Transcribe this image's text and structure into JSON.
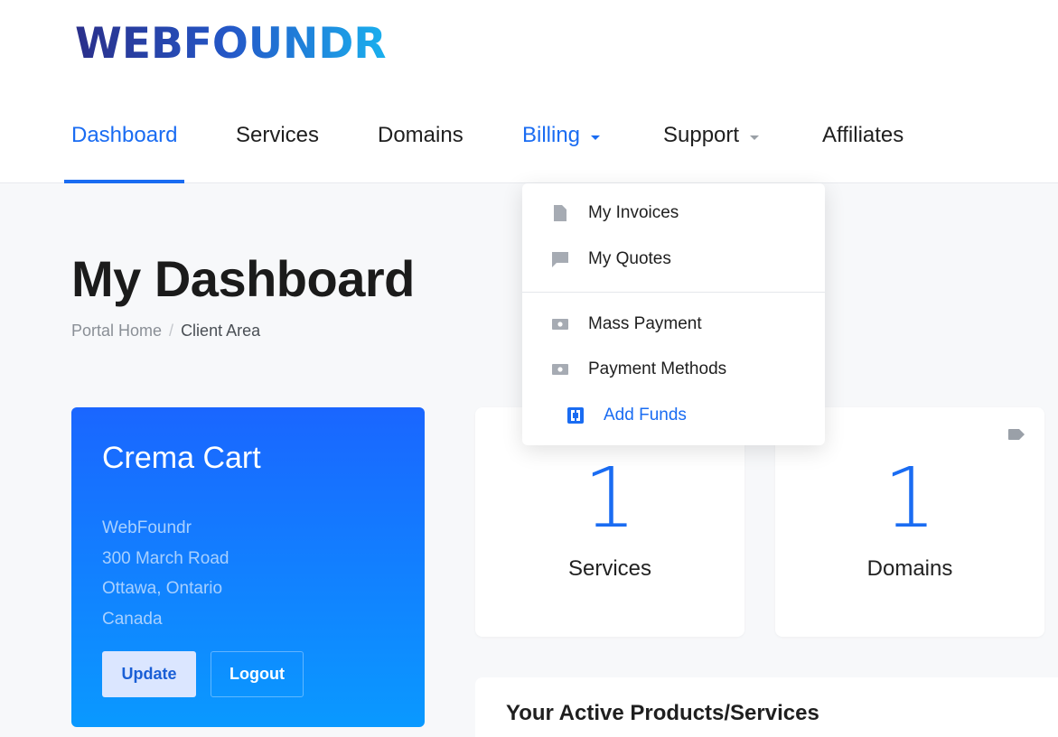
{
  "brand": {
    "logo_text": "WEBFOUNDR",
    "accent": "#1a6cf2"
  },
  "nav": {
    "items": [
      {
        "label": "Dashboard"
      },
      {
        "label": "Services"
      },
      {
        "label": "Domains"
      },
      {
        "label": "Billing"
      },
      {
        "label": "Support"
      },
      {
        "label": "Affiliates"
      }
    ]
  },
  "billing_menu": {
    "items": [
      {
        "label": "My Invoices",
        "icon": "file-icon"
      },
      {
        "label": "My Quotes",
        "icon": "comment-icon"
      },
      {
        "label": "Mass Payment",
        "icon": "money-icon"
      },
      {
        "label": "Payment Methods",
        "icon": "money-icon"
      },
      {
        "label": "Add Funds",
        "icon": "funds-icon"
      }
    ]
  },
  "page": {
    "title": "My Dashboard",
    "breadcrumb": [
      "Portal Home",
      "/",
      "Client Area"
    ]
  },
  "profile": {
    "name": "Crema Cart",
    "address": [
      "WebFoundr",
      "300 March Road",
      "Ottawa, Ontario",
      "Canada"
    ],
    "update_label": "Update",
    "logout_label": "Logout"
  },
  "stats": [
    {
      "value": "1",
      "label": "Services"
    },
    {
      "value": "1",
      "label": "Domains"
    }
  ],
  "products": {
    "title": "Your Active Products/Services"
  }
}
